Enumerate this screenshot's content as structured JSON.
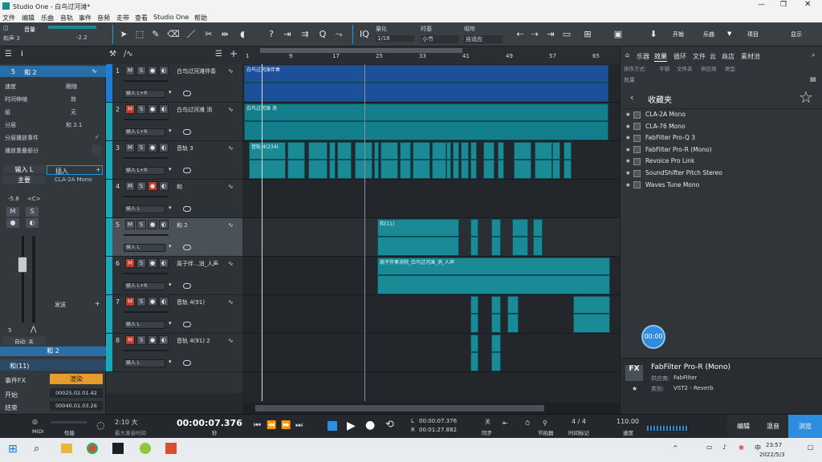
{
  "app": {
    "title": "Studio One - 白鸟过河滩*"
  },
  "menu": [
    "文件",
    "编辑",
    "乐曲",
    "音轨",
    "事件",
    "音频",
    "走带",
    "查看",
    "Studio One",
    "帮助"
  ],
  "toolbar": {
    "song_label": "音量",
    "track_label": "和声 3",
    "volume": "-2.2",
    "quantize_label": "量化",
    "quantize_value": "1/16",
    "timebase_label": "时基",
    "timebase_value": "小节",
    "snap_label": "吸附",
    "snap_value": "自适应",
    "start_label": "开始",
    "song_btn": "乐曲",
    "project_btn": "项目",
    "show_btn": "显示"
  },
  "inspector": {
    "track_num": "5",
    "track_name": "和 2",
    "rows": [
      {
        "k": "速度",
        "v": "跟随"
      },
      {
        "k": "时间伸缩",
        "v": "效"
      },
      {
        "k": "组",
        "v": "无"
      },
      {
        "k": "分层",
        "v": "和 2.1"
      },
      {
        "k": "分层播放事件",
        "v": "✓"
      },
      {
        "k": "播放重叠部分",
        "v": ""
      }
    ],
    "input": "输入 L",
    "output": "主要",
    "pan_val": "-5.8",
    "pan": "<C>",
    "insert_label": "插入",
    "insert_item": "CLA-2A Mono",
    "send_label": "发送",
    "channel_num": "5",
    "auto_label": "自动: 关",
    "track_footer": "和 2",
    "event_title": "和(11)",
    "event_fx": "事件FX",
    "event_fx_btn": "渲染",
    "start_label": "开始",
    "start_val": "00025.02.01.42",
    "end_label": "结束",
    "end_val": "00040.01.03.26"
  },
  "tracks": [
    {
      "num": "1",
      "name": "白鸟过河滩伴奏",
      "input": "输入 L+R",
      "color": "#1f7dd6",
      "muted": false
    },
    {
      "num": "2",
      "name": "白鸟过河滩 消",
      "input": "输入 L+R",
      "color": "#1aa7b8",
      "muted": true
    },
    {
      "num": "3",
      "name": "音轨 3",
      "input": "输入 L+R",
      "color": "#1aa7b8",
      "muted": false
    },
    {
      "num": "4",
      "name": "和",
      "input": "输入 L",
      "color": "#1aa7b8",
      "muted": false
    },
    {
      "num": "5",
      "name": "和 2",
      "input": "输入 L",
      "color": "#1aa7b8",
      "muted": false
    },
    {
      "num": "6",
      "name": "周子伴...消_人声",
      "input": "输入 L+R",
      "color": "#1aa7b8",
      "muted": true
    },
    {
      "num": "7",
      "name": "音轨 4(91)",
      "input": "输入 L",
      "color": "#1aa7b8",
      "muted": true
    },
    {
      "num": "8",
      "name": "音轨 4(91) 2",
      "input": "输入 L",
      "color": "#1aa7b8",
      "muted": true
    }
  ],
  "ruler": [
    "1",
    "9",
    "17",
    "25",
    "33",
    "41",
    "49",
    "57",
    "65"
  ],
  "clips": {
    "c1": "白鸟过河滩伴奏",
    "c2": "白鸟过河滩 消",
    "c3": "音轨 4(234)",
    "c5": "和(11)",
    "c6": "周子伴奏消除_白鸟过河滩_消_人声"
  },
  "browser": {
    "tabs": [
      "乐器",
      "效果",
      "循环",
      "文件",
      "云",
      "商店",
      "素材池"
    ],
    "subtabs": [
      "排序方式:",
      "平铺",
      "文件夹",
      "供应商",
      "类型"
    ],
    "breadcrumb": "效果",
    "folder": "收藏夹",
    "favorites": [
      "CLA-2A Mono",
      "CLA-76 Mono",
      "FabFilter Pro-Q 3",
      "FabFilter Pro-R (Mono)",
      "Revoice Pro Link",
      "SoundShifter Pitch Stereo",
      "Waves Tune Mono"
    ],
    "badge": "00:00",
    "plugin_name": "FabFilter Pro-R (Mono)",
    "vendor_label": "供应商:",
    "vendor": "FabFilter",
    "cat_label": "类别:",
    "category": "VST2 - Reverb"
  },
  "transport": {
    "midi": "MIDI",
    "perf": "性能",
    "sig": "2:10 大",
    "sig_sub": "最大录音时间",
    "time": "00:00:07.376",
    "time_unit": "秒",
    "L": "00:00:07.376",
    "R": "00:01:27.882",
    "sync": "关",
    "sync_lbl": "同步",
    "metronome": "节拍器",
    "timesig": "4 / 4",
    "timesig_lbl": "时间标记",
    "tempo": "110.00",
    "tempo_lbl": "速度",
    "edit": "编辑",
    "mix": "混音",
    "browse": "浏览"
  },
  "taskbar": {
    "time": "23:57",
    "date": "2022/5/3"
  }
}
